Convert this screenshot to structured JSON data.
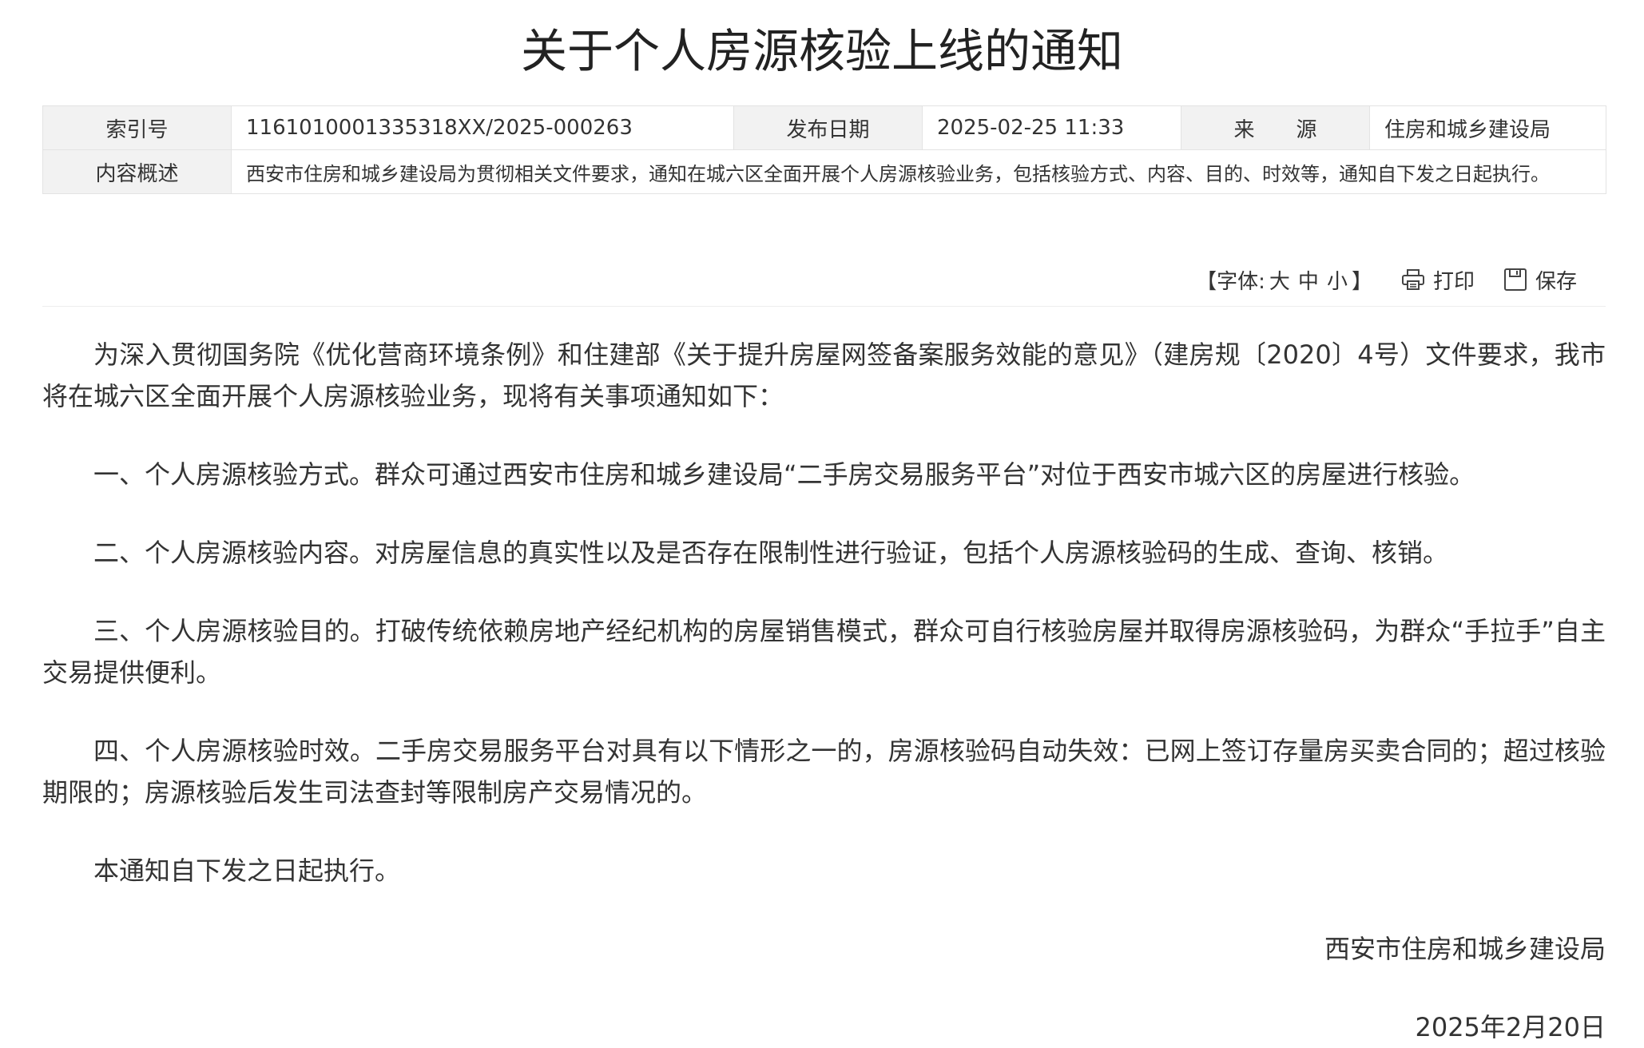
{
  "title": "关于个人房源核验上线的通知",
  "meta": {
    "index_label": "索引号",
    "index_value": "1161010001335318XX/2025-000263",
    "date_label": "发布日期",
    "date_value": "2025-02-25 11:33",
    "source_label": "来　　源",
    "source_value": "住房和城乡建设局",
    "summary_label": "内容概述",
    "summary_value": "西安市住房和城乡建设局为贯彻相关文件要求，通知在城六区全面开展个人房源核验业务，包括核验方式、内容、目的、时效等，通知自下发之日起执行。"
  },
  "toolbar": {
    "font_prefix": "【字体:",
    "font_large": "大",
    "font_medium": "中",
    "font_small": "小",
    "font_suffix": "】",
    "print_label": "打印",
    "save_label": "保存"
  },
  "body": {
    "paragraphs": [
      "为深入贯彻国务院《优化营商环境条例》和住建部《关于提升房屋网签备案服务效能的意见》（建房规〔2020〕4号）文件要求，我市将在城六区全面开展个人房源核验业务，现将有关事项通知如下：",
      "一、个人房源核验方式。群众可通过西安市住房和城乡建设局“二手房交易服务平台”对位于西安市城六区的房屋进行核验。",
      "二、个人房源核验内容。对房屋信息的真实性以及是否存在限制性进行验证，包括个人房源核验码的生成、查询、核销。",
      "三、个人房源核验目的。打破传统依赖房地产经纪机构的房屋销售模式，群众可自行核验房屋并取得房源核验码，为群众“手拉手”自主交易提供便利。",
      "四、个人房源核验时效。二手房交易服务平台对具有以下情形之一的，房源核验码自动失效：已网上签订存量房买卖合同的；超过核验期限的；房源核验后发生司法查封等限制房产交易情况的。",
      "本通知自下发之日起执行。"
    ],
    "signature": "西安市住房和城乡建设局",
    "date": "2025年2月20日"
  },
  "colors": {
    "label_bg": "#f2f2f2",
    "border": "#e3e3e3",
    "text": "#333333"
  },
  "icons": {
    "print": "printer-icon",
    "save": "floppy-disk-icon"
  }
}
